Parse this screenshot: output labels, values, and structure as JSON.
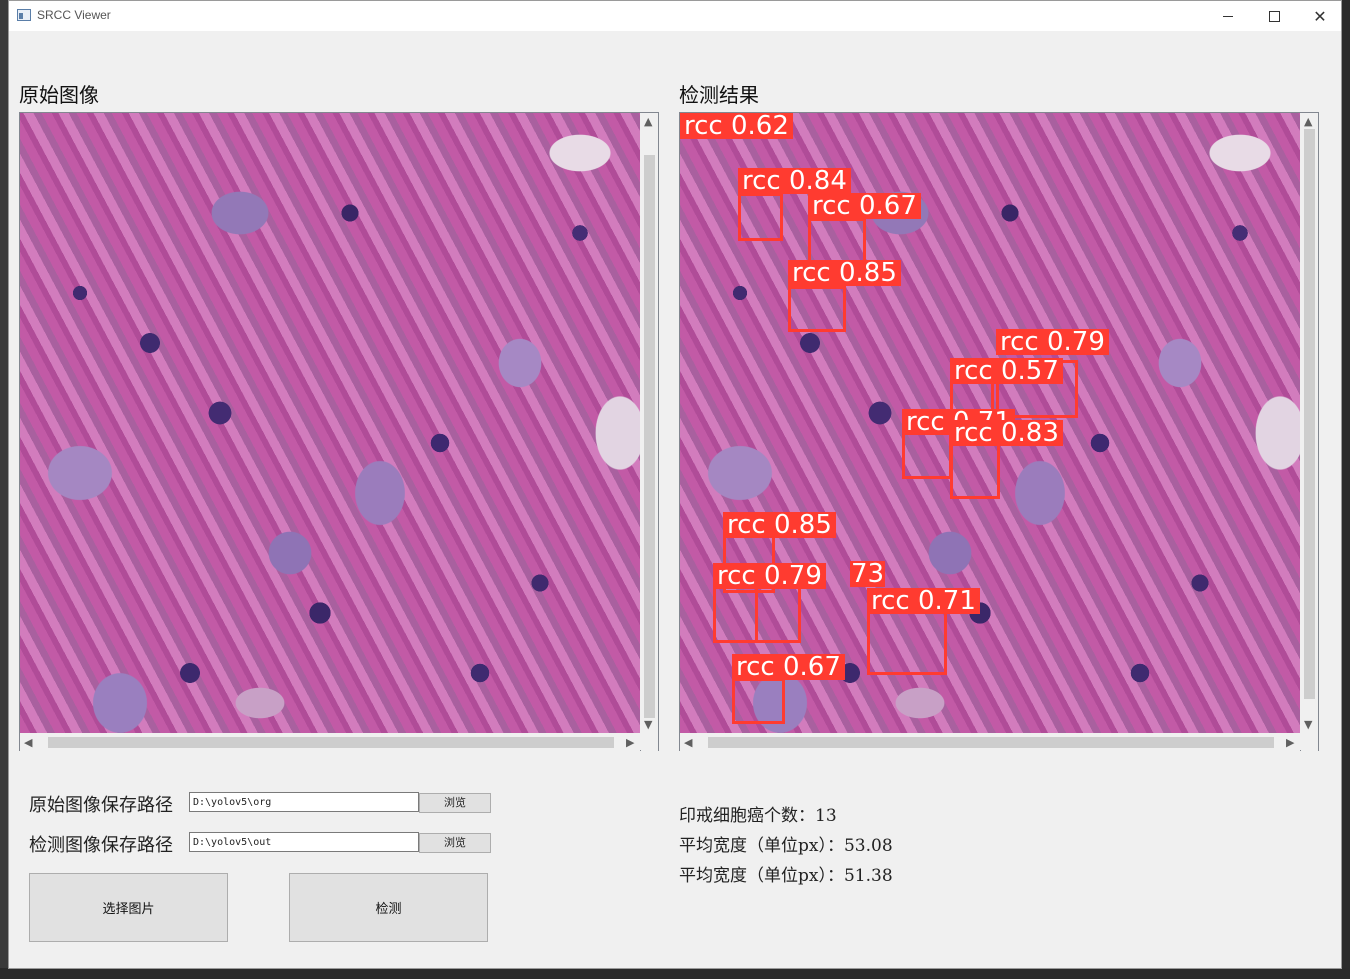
{
  "window": {
    "title": "SRCC Viewer",
    "controls": {
      "minimize": "",
      "maximize": "",
      "close": "✕"
    }
  },
  "panels": {
    "original": {
      "title": "原始图像"
    },
    "result": {
      "title": "检测结果"
    }
  },
  "detections": [
    {
      "label": "rcc 0.62"
    },
    {
      "label": "rcc 0.84"
    },
    {
      "label": "rcc 0.67"
    },
    {
      "label": "rcc 0.85"
    },
    {
      "label": "rcc 0.79"
    },
    {
      "label": "rcc 0.57"
    },
    {
      "label": "rcc 0.71"
    },
    {
      "label": "rcc 0.83"
    },
    {
      "label": "rcc 0.85"
    },
    {
      "label": "rcc 0.79"
    },
    {
      "label": "73"
    },
    {
      "label": "rcc 0.71"
    },
    {
      "label": "rcc 0.67"
    }
  ],
  "form": {
    "org_path_label": "原始图像保存路径",
    "org_path_value": "D:\\yolov5\\org",
    "out_path_label": "检测图像保存路径",
    "out_path_value": "D:\\yolov5\\out",
    "browse_label": "浏览",
    "select_button": "选择图片",
    "detect_button": "检测"
  },
  "stats": {
    "count_line": "印戒细胞癌个数：13",
    "width_line": "平均宽度（单位px）：53.08",
    "height_line": "平均宽度（单位px）：51.38"
  },
  "colors": {
    "detection": "#ff3b30",
    "window_bg": "#f0f0f0"
  }
}
